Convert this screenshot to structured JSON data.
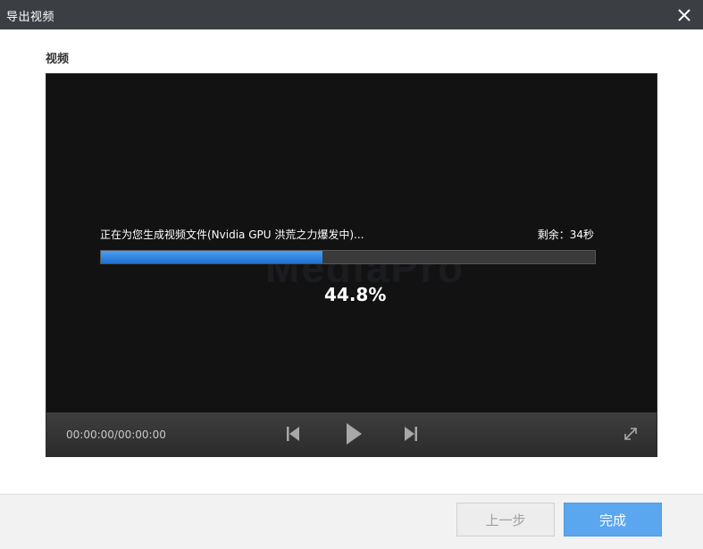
{
  "window": {
    "title": "导出视频"
  },
  "section": {
    "label": "视频"
  },
  "player": {
    "watermark": "MediaPro",
    "status_text": "正在为您生成视频文件(Nvidia GPU 洪荒之力爆发中)...",
    "remaining_text": "剩余：34秒",
    "progress_percent": 44.8,
    "progress_label": "44.8%",
    "timecode": "00:00:00/00:00:00"
  },
  "footer": {
    "prev_label": "上一步",
    "finish_label": "完成"
  },
  "icons": {
    "close": "close-icon",
    "prev": "skip-previous-icon",
    "play": "play-icon",
    "next": "skip-next-icon",
    "fullscreen": "fullscreen-icon"
  },
  "colors": {
    "titlebar": "#3b3f44",
    "progress_fill": "#2f86e6",
    "finish_button": "#5aa7ef"
  }
}
